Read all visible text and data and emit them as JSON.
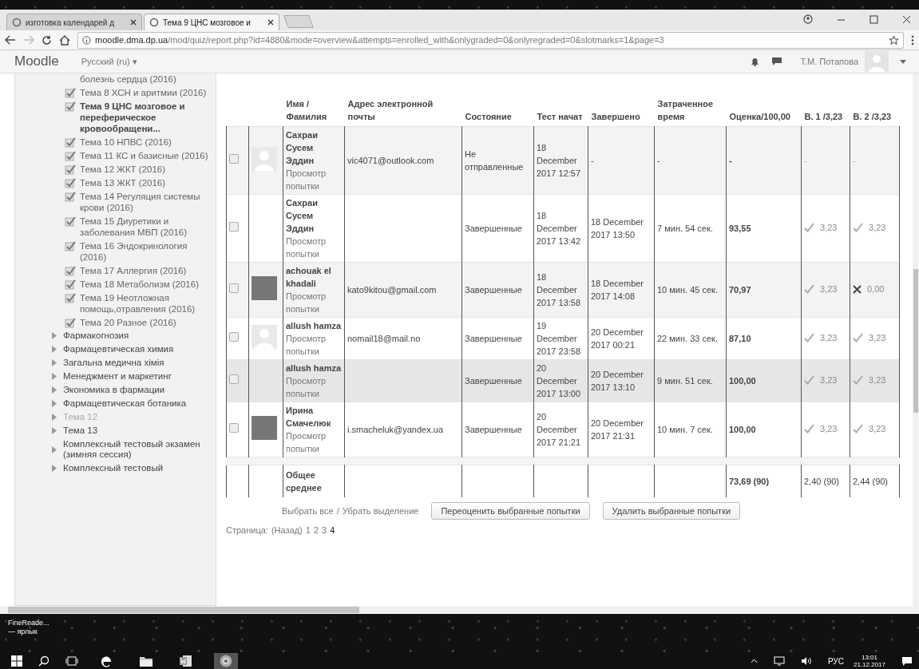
{
  "browser": {
    "tabs": [
      {
        "label": "изготовка календарей д",
        "selected": false
      },
      {
        "label": "Тема 9 ЦНС мозговое и",
        "selected": true
      }
    ],
    "url_host": "moodle.dma.dp.ua",
    "url_path": "/mod/quiz/report.php?id=4880&mode=overview&attempts=enrolled_with&onlygraded=0&onlyregraded=0&slotmarks=1&page=3"
  },
  "navbar": {
    "brand": "Moodle",
    "language": "Русский (ru) ▾",
    "user": "Т.М. Потапова"
  },
  "sidebar": {
    "activities": [
      {
        "label": "болезнь сердца (2016)",
        "icon": false,
        "selected": false
      },
      {
        "label": "Тема 8 ХСН и аритмии (2016)",
        "icon": true,
        "selected": false
      },
      {
        "label": "Тема 9 ЦНС мозговое и переферическое кровообращени...",
        "icon": true,
        "selected": true
      },
      {
        "label": "Тема 10 НПВС (2016)",
        "icon": true,
        "selected": false
      },
      {
        "label": "Тема 11 КС и базисные (2016)",
        "icon": true,
        "selected": false
      },
      {
        "label": "Тема 12 ЖКТ (2016)",
        "icon": true,
        "selected": false
      },
      {
        "label": "Тема 13 ЖКТ (2016)",
        "icon": true,
        "selected": false
      },
      {
        "label": "Тема 14 Регуляция системы крови (2016)",
        "icon": true,
        "selected": false
      },
      {
        "label": "Тема 15 Диуретики и заболевания МВП (2016)",
        "icon": true,
        "selected": false
      },
      {
        "label": "Тема 16 Эндокринология (2016)",
        "icon": true,
        "selected": false
      },
      {
        "label": "Тема 17 Аллергия (2016)",
        "icon": true,
        "selected": false
      },
      {
        "label": "Тема 18 Метаболизм (2016)",
        "icon": true,
        "selected": false
      },
      {
        "label": "Тема 19 Неотложная помощь,отравления (2016)",
        "icon": true,
        "selected": false
      },
      {
        "label": "Тема 20 Разное (2016)",
        "icon": true,
        "selected": false
      }
    ],
    "sections": [
      {
        "label": "Фармакогнозия",
        "dimmed": false
      },
      {
        "label": "Фармацевтическая химия",
        "dimmed": false
      },
      {
        "label": "Загальна медична хімія",
        "dimmed": false
      },
      {
        "label": "Менеджмент и маркетинг",
        "dimmed": false
      },
      {
        "label": "Экономика в фармации",
        "dimmed": false
      },
      {
        "label": "Фармацевтическая ботаника",
        "dimmed": false
      },
      {
        "label": "Тема 12",
        "dimmed": true
      },
      {
        "label": "Тема 13",
        "dimmed": false
      },
      {
        "label": "Комплексный тестовый экзамен (зимняя сессия)",
        "dimmed": false
      },
      {
        "label": "Комплексный тестовый",
        "dimmed": false
      }
    ]
  },
  "table": {
    "columns": [
      "Имя / Фамилия",
      "Адрес электронной почты",
      "Состояние",
      "Тест начат",
      "Завершено",
      "Затраченное время",
      "Оценка/100,00",
      "В. 1 /3,23",
      "В. 2 /3,23"
    ],
    "rows": [
      {
        "checked": false,
        "avatar": {
          "kind": "default"
        },
        "name": "Сахраи Сусем Эддин",
        "link": "Просмотр попытки",
        "email": "vic4071@outlook.com",
        "state": "Не отправленные",
        "started": "18 December 2017 12:57",
        "finished": "-",
        "duration": "-",
        "grade": "-",
        "q": [
          {
            "value": "-"
          },
          {
            "value": "-"
          }
        ],
        "highlighted": false
      },
      {
        "checked": false,
        "name": "Сахраи Сусем Эддин",
        "link": "Просмотр попытки",
        "state": "Завершенные",
        "started": "18 December 2017 13:42",
        "finished": "18 December 2017 13:50",
        "duration": "7 мин. 54 сек.",
        "grade": "93,55",
        "q": [
          {
            "kind": "correct",
            "value": "3,23"
          },
          {
            "kind": "correct",
            "value": "3,23"
          }
        ],
        "highlighted": false
      },
      {
        "checked": false,
        "avatar": {
          "kind": "photo"
        },
        "name": "achouak el khadali",
        "link": "Просмотр попытки",
        "email": "kato9kitou@gmail.com",
        "state": "Завершенные",
        "started": "18 December 2017 13:58",
        "finished": "18 December 2017 14:08",
        "duration": "10 мин. 45 сек.",
        "grade": "70,97",
        "q": [
          {
            "kind": "correct",
            "value": "3,23"
          },
          {
            "kind": "incorrect",
            "value": "0,00"
          }
        ],
        "highlighted": false
      },
      {
        "checked": false,
        "avatar": {
          "kind": "default"
        },
        "name": "allush hamza",
        "link": "Просмотр попытки",
        "email": "nomail18@mail.no",
        "state": "Завершенные",
        "started": "19 December 2017 23:58",
        "finished": "20 December 2017 00:21",
        "duration": "22 мин. 33 сек.",
        "grade": "87,10",
        "q": [
          {
            "kind": "correct",
            "value": "3,23"
          },
          {
            "kind": "correct",
            "value": "3,23"
          }
        ],
        "highlighted": false
      },
      {
        "checked": false,
        "name": "allush hamza",
        "link": "Просмотр попытки",
        "state": "Завершенные",
        "started": "20 December 2017 13:00",
        "finished": "20 December 2017 13:10",
        "duration": "9 мин. 51 сек.",
        "grade": "100,00",
        "q": [
          {
            "kind": "correct",
            "value": "3,23"
          },
          {
            "kind": "correct",
            "value": "3,23"
          }
        ],
        "highlighted": true
      },
      {
        "checked": false,
        "avatar": {
          "kind": "photo"
        },
        "name": "Ирина Смачелюк",
        "link": "Просмотр попытки",
        "email": "i.smacheluk@yandex.ua",
        "state": "Завершенные",
        "started": "20 December 2017 21:21",
        "finished": "20 December 2017 21:31",
        "duration": "10 мин. 7 сек.",
        "grade": "100,00",
        "q": [
          {
            "kind": "correct",
            "value": "3,23"
          },
          {
            "kind": "correct",
            "value": "3,23"
          }
        ],
        "highlighted": false
      }
    ],
    "total": {
      "label": "Общее среднее",
      "grade": "73,69 (90)",
      "q": [
        "2,40 (90)",
        "2,44 (90)"
      ]
    }
  },
  "actions": {
    "select_all": "Выбрать все",
    "deselect": "Убрать выделение",
    "separator": "/",
    "buttons": [
      "Переоценить выбранные попытки",
      "Удалить выбранные попытки"
    ]
  },
  "pagination": {
    "label": "Страница:",
    "prev": "(Назад)",
    "pages": [
      {
        "label": "1",
        "selected": false
      },
      {
        "label": "2",
        "selected": false
      },
      {
        "label": "3",
        "selected": false
      },
      {
        "label": "4",
        "selected": true
      }
    ]
  },
  "desktop": {
    "shortcut": [
      "FineReade...",
      "— ярлык"
    ]
  },
  "taskbar": {
    "apps": [
      {
        "kind": "edge",
        "active": false
      },
      {
        "kind": "explorer",
        "active": false
      },
      {
        "kind": "word",
        "active": false
      },
      {
        "kind": "chrome",
        "active": true
      }
    ],
    "language": "РУС",
    "time": "13:01",
    "date": "21.12.2017"
  }
}
